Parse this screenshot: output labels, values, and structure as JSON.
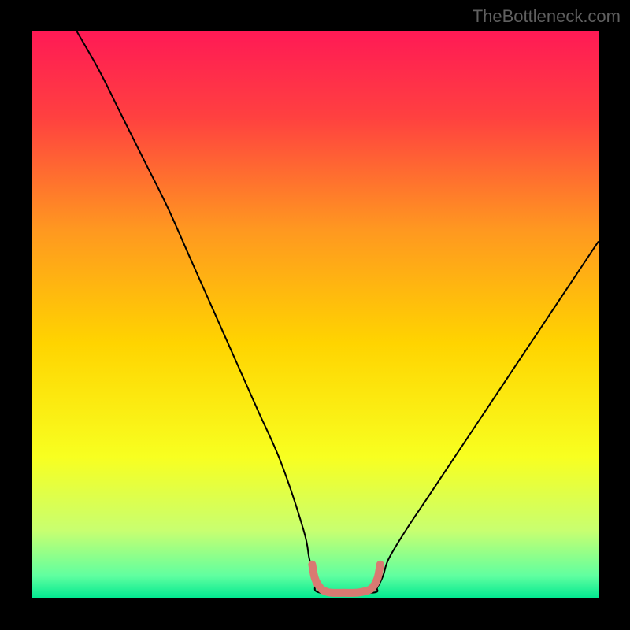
{
  "watermark": "TheBottleneck.com",
  "chart_data": {
    "type": "line",
    "title": "",
    "xlabel": "",
    "ylabel": "",
    "xlim": [
      0,
      100
    ],
    "ylim": [
      0,
      100
    ],
    "background_gradient": {
      "stops": [
        {
          "offset": 0.0,
          "color": "#ff1a55"
        },
        {
          "offset": 0.15,
          "color": "#ff4040"
        },
        {
          "offset": 0.35,
          "color": "#ff9820"
        },
        {
          "offset": 0.55,
          "color": "#ffd400"
        },
        {
          "offset": 0.75,
          "color": "#f8ff20"
        },
        {
          "offset": 0.88,
          "color": "#c8ff70"
        },
        {
          "offset": 0.96,
          "color": "#60ffa0"
        },
        {
          "offset": 1.0,
          "color": "#00e890"
        }
      ]
    },
    "frame_color": "#000000",
    "frame_thickness_px": 40,
    "series": [
      {
        "name": "bottleneck-curve",
        "color": "#000000",
        "width": 2,
        "x": [
          8,
          12,
          16,
          20,
          24,
          28,
          32,
          36,
          40,
          44,
          48,
          49,
          50,
          51,
          60,
          61,
          62,
          63,
          66,
          70,
          74,
          78,
          82,
          86,
          90,
          94,
          98,
          100
        ],
        "y": [
          100,
          93,
          85,
          77,
          69,
          60,
          51,
          42,
          33,
          24,
          12,
          7,
          3,
          1,
          1,
          2,
          4,
          7,
          12,
          18,
          24,
          30,
          36,
          42,
          48,
          54,
          60,
          63
        ]
      },
      {
        "name": "optimal-range-marker",
        "color": "#d97a72",
        "width": 10,
        "linecap": "round",
        "x": [
          49.5,
          50,
          51,
          52,
          53,
          55,
          57,
          58.5,
          60,
          61,
          61.5
        ],
        "y": [
          6,
          3.5,
          1.8,
          1.2,
          1.0,
          1.0,
          1.0,
          1.2,
          1.8,
          3.5,
          6
        ]
      }
    ]
  }
}
